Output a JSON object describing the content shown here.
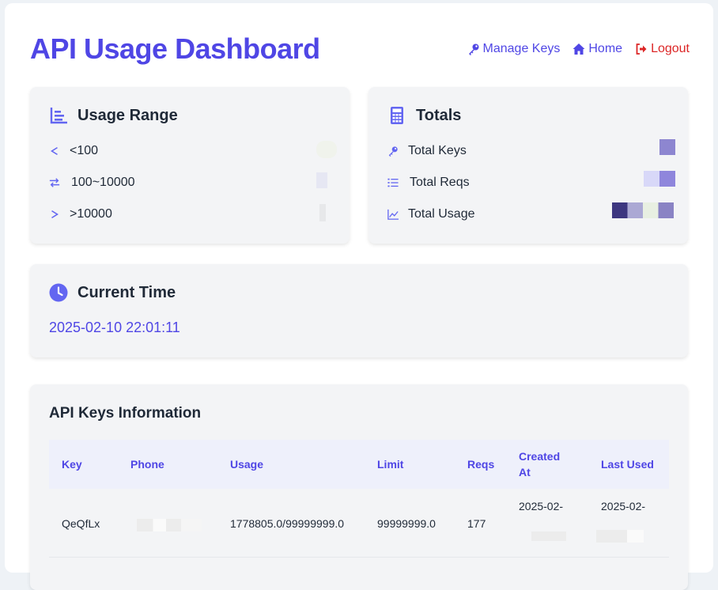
{
  "header": {
    "title": "API Usage Dashboard",
    "nav": {
      "manage_keys": "Manage Keys",
      "home": "Home",
      "logout": "Logout"
    }
  },
  "usage_range": {
    "title": "Usage Range",
    "items": [
      {
        "icon": "less-than-icon",
        "label": "<100"
      },
      {
        "icon": "exchange-icon",
        "label": "100~10000"
      },
      {
        "icon": "greater-than-icon",
        "label": ">10000"
      }
    ]
  },
  "totals": {
    "title": "Totals",
    "items": [
      {
        "icon": "key-icon",
        "label": "Total Keys"
      },
      {
        "icon": "list-icon",
        "label": "Total Reqs"
      },
      {
        "icon": "line-chart-icon",
        "label": "Total Usage"
      }
    ]
  },
  "current_time": {
    "title": "Current Time",
    "value": "2025-02-10 22:01:11"
  },
  "api_keys": {
    "title": "API Keys Information",
    "columns": [
      "Key",
      "Phone",
      "Usage",
      "Limit",
      "Reqs",
      "Created At",
      "Last Used"
    ],
    "rows": [
      {
        "key": "QeQfLx",
        "usage": "1778805.0/99999999.0",
        "limit": "99999999.0",
        "reqs": "177",
        "created_at": "2025-02-",
        "last_used": "2025-02-"
      }
    ]
  },
  "colors": {
    "accent": "#4f46e5",
    "danger": "#dc2626",
    "card_bg": "#f3f4f6"
  }
}
